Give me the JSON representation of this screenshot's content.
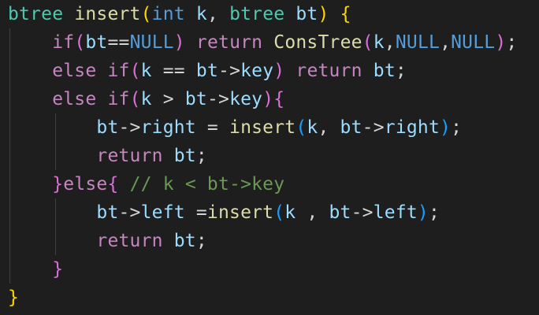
{
  "editor": {
    "theme_colors": {
      "background": "#1e1e1e",
      "type": "#4ec9b0",
      "function": "#dcdcaa",
      "keyword": "#569cd6",
      "control": "#c586c0",
      "variable": "#9cdcfe",
      "comment": "#6a9955",
      "plain": "#d4d4d4",
      "bracket_level1": "#ffd700",
      "bracket_level2": "#da70d6",
      "bracket_level3": "#179fff"
    },
    "lines": [
      [
        {
          "c": "t-type",
          "t": "btree"
        },
        {
          "c": "t-pl",
          "t": " "
        },
        {
          "c": "t-fn",
          "t": "insert"
        },
        {
          "c": "t-br1",
          "t": "("
        },
        {
          "c": "t-kw",
          "t": "int"
        },
        {
          "c": "t-pl",
          "t": " "
        },
        {
          "c": "t-var",
          "t": "k"
        },
        {
          "c": "t-pl",
          "t": ", "
        },
        {
          "c": "t-type",
          "t": "btree"
        },
        {
          "c": "t-pl",
          "t": " "
        },
        {
          "c": "t-var",
          "t": "bt"
        },
        {
          "c": "t-br1",
          "t": ")"
        },
        {
          "c": "t-pl",
          "t": " "
        },
        {
          "c": "t-br1",
          "t": "{"
        }
      ],
      [
        {
          "c": "t-pl",
          "t": "    "
        },
        {
          "c": "t-ctl",
          "t": "if"
        },
        {
          "c": "t-br2",
          "t": "("
        },
        {
          "c": "t-var",
          "t": "bt"
        },
        {
          "c": "t-pl",
          "t": "=="
        },
        {
          "c": "t-const",
          "t": "NULL"
        },
        {
          "c": "t-br2",
          "t": ")"
        },
        {
          "c": "t-pl",
          "t": " "
        },
        {
          "c": "t-ctl",
          "t": "return"
        },
        {
          "c": "t-pl",
          "t": " "
        },
        {
          "c": "t-fn",
          "t": "ConsTree"
        },
        {
          "c": "t-br2",
          "t": "("
        },
        {
          "c": "t-var",
          "t": "k"
        },
        {
          "c": "t-pl",
          "t": ","
        },
        {
          "c": "t-const",
          "t": "NULL"
        },
        {
          "c": "t-pl",
          "t": ","
        },
        {
          "c": "t-const",
          "t": "NULL"
        },
        {
          "c": "t-br2",
          "t": ")"
        },
        {
          "c": "t-pl",
          "t": ";"
        }
      ],
      [
        {
          "c": "t-pl",
          "t": "    "
        },
        {
          "c": "t-ctl",
          "t": "else"
        },
        {
          "c": "t-pl",
          "t": " "
        },
        {
          "c": "t-ctl",
          "t": "if"
        },
        {
          "c": "t-br2",
          "t": "("
        },
        {
          "c": "t-var",
          "t": "k"
        },
        {
          "c": "t-pl",
          "t": " == "
        },
        {
          "c": "t-var",
          "t": "bt"
        },
        {
          "c": "t-pl",
          "t": "->"
        },
        {
          "c": "t-var",
          "t": "key"
        },
        {
          "c": "t-br2",
          "t": ")"
        },
        {
          "c": "t-pl",
          "t": " "
        },
        {
          "c": "t-ctl",
          "t": "return"
        },
        {
          "c": "t-pl",
          "t": " "
        },
        {
          "c": "t-var",
          "t": "bt"
        },
        {
          "c": "t-pl",
          "t": ";"
        }
      ],
      [
        {
          "c": "t-pl",
          "t": "    "
        },
        {
          "c": "t-ctl",
          "t": "else"
        },
        {
          "c": "t-pl",
          "t": " "
        },
        {
          "c": "t-ctl",
          "t": "if"
        },
        {
          "c": "t-br2",
          "t": "("
        },
        {
          "c": "t-var",
          "t": "k"
        },
        {
          "c": "t-pl",
          "t": " > "
        },
        {
          "c": "t-var",
          "t": "bt"
        },
        {
          "c": "t-pl",
          "t": "->"
        },
        {
          "c": "t-var",
          "t": "key"
        },
        {
          "c": "t-br2",
          "t": ")"
        },
        {
          "c": "t-br2",
          "t": "{"
        }
      ],
      [
        {
          "c": "t-pl",
          "t": "        "
        },
        {
          "c": "t-var",
          "t": "bt"
        },
        {
          "c": "t-pl",
          "t": "->"
        },
        {
          "c": "t-var",
          "t": "right"
        },
        {
          "c": "t-pl",
          "t": " = "
        },
        {
          "c": "t-fn",
          "t": "insert"
        },
        {
          "c": "t-br3",
          "t": "("
        },
        {
          "c": "t-var",
          "t": "k"
        },
        {
          "c": "t-pl",
          "t": ", "
        },
        {
          "c": "t-var",
          "t": "bt"
        },
        {
          "c": "t-pl",
          "t": "->"
        },
        {
          "c": "t-var",
          "t": "right"
        },
        {
          "c": "t-br3",
          "t": ")"
        },
        {
          "c": "t-pl",
          "t": ";"
        }
      ],
      [
        {
          "c": "t-pl",
          "t": "        "
        },
        {
          "c": "t-ctl",
          "t": "return"
        },
        {
          "c": "t-pl",
          "t": " "
        },
        {
          "c": "t-var",
          "t": "bt"
        },
        {
          "c": "t-pl",
          "t": ";"
        }
      ],
      [
        {
          "c": "t-pl",
          "t": "    "
        },
        {
          "c": "t-br2",
          "t": "}"
        },
        {
          "c": "t-ctl",
          "t": "else"
        },
        {
          "c": "t-br2",
          "t": "{"
        },
        {
          "c": "t-pl",
          "t": " "
        },
        {
          "c": "t-cmt",
          "t": "// k < bt->key"
        }
      ],
      [
        {
          "c": "t-pl",
          "t": "        "
        },
        {
          "c": "t-var",
          "t": "bt"
        },
        {
          "c": "t-pl",
          "t": "->"
        },
        {
          "c": "t-var",
          "t": "left"
        },
        {
          "c": "t-pl",
          "t": " ="
        },
        {
          "c": "t-fn",
          "t": "insert"
        },
        {
          "c": "t-br3",
          "t": "("
        },
        {
          "c": "t-var",
          "t": "k"
        },
        {
          "c": "t-pl",
          "t": " , "
        },
        {
          "c": "t-var",
          "t": "bt"
        },
        {
          "c": "t-pl",
          "t": "->"
        },
        {
          "c": "t-var",
          "t": "left"
        },
        {
          "c": "t-br3",
          "t": ")"
        },
        {
          "c": "t-pl",
          "t": ";"
        }
      ],
      [
        {
          "c": "t-pl",
          "t": "        "
        },
        {
          "c": "t-ctl",
          "t": "return"
        },
        {
          "c": "t-pl",
          "t": " "
        },
        {
          "c": "t-var",
          "t": "bt"
        },
        {
          "c": "t-pl",
          "t": ";"
        }
      ],
      [
        {
          "c": "t-pl",
          "t": "    "
        },
        {
          "c": "t-br2",
          "t": "}"
        }
      ],
      [
        {
          "c": "t-br1",
          "t": "}"
        }
      ]
    ]
  }
}
